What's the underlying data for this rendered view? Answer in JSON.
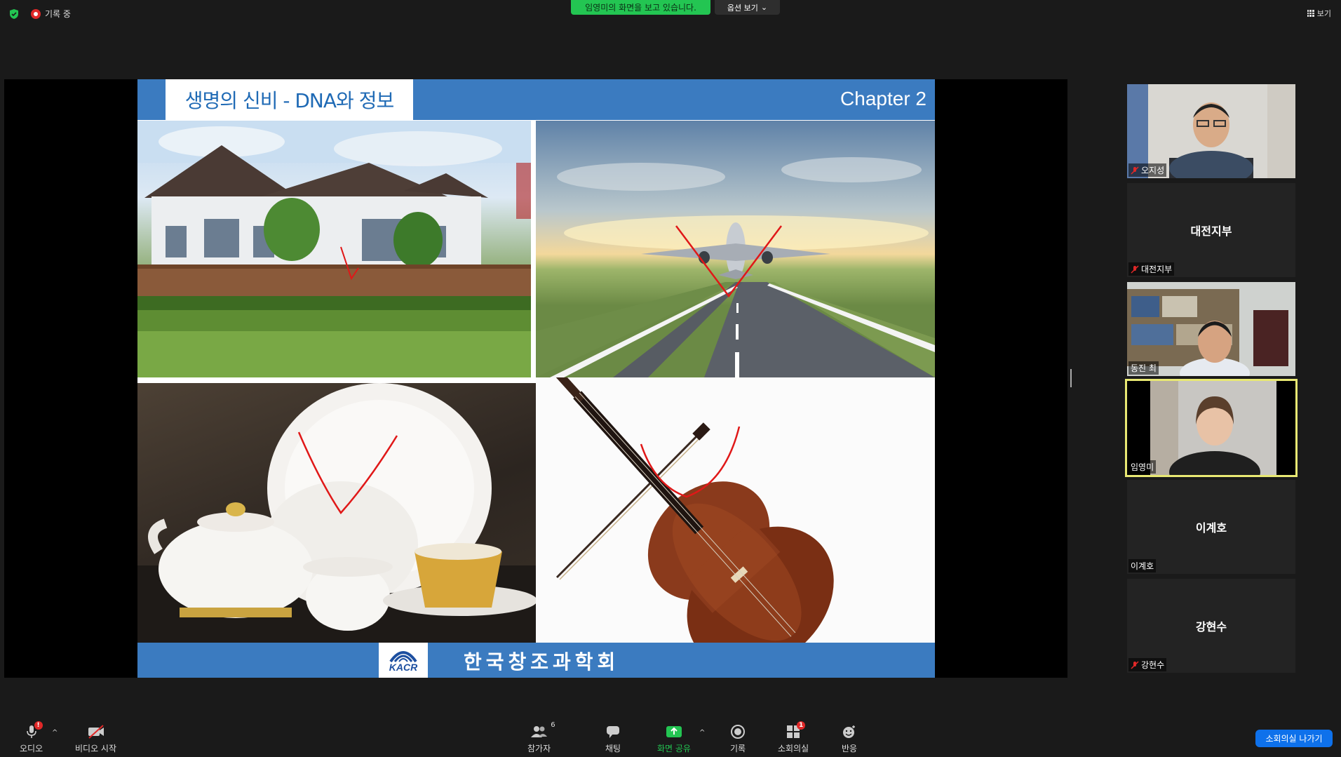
{
  "topbar": {
    "recording_label": "기록 중",
    "sharing_banner": "임영미의 화면을 보고 있습니다.",
    "options_label": "옵션 보기",
    "view_label": "보기"
  },
  "slide": {
    "title": "생명의 신비 - DNA와 정보",
    "chapter": "Chapter 2",
    "logo_text": "KACR",
    "organization": "한국창조과학회",
    "panels": [
      "house",
      "airplane",
      "china-tableware",
      "cello"
    ]
  },
  "participants": [
    {
      "name": "오지성",
      "type": "video",
      "muted": true
    },
    {
      "name": "대전지부",
      "display": "대전지부",
      "type": "name",
      "muted": true
    },
    {
      "name": "동진 최",
      "type": "video",
      "muted": false
    },
    {
      "name": "임영미",
      "type": "video",
      "muted": false,
      "active_speaker": true
    },
    {
      "name": "이계호",
      "display": "이계호",
      "type": "name",
      "muted": false
    },
    {
      "name": "강현수",
      "display": "강현수",
      "type": "name",
      "muted": true
    }
  ],
  "toolbar": {
    "audio": "오디오",
    "audio_badge": "!",
    "video": "비디오 시작",
    "participants": "참가자",
    "participants_count": "6",
    "chat": "채팅",
    "share": "화면 공유",
    "record": "기록",
    "breakout": "소회의실",
    "breakout_badge": "1",
    "reactions": "반응",
    "leave_breakout": "소회의실 나가기"
  },
  "colors": {
    "slide_blue": "#3b7bc0",
    "share_green": "#23c552",
    "active_speaker": "#e8e873",
    "leave_blue": "#0e71eb"
  }
}
